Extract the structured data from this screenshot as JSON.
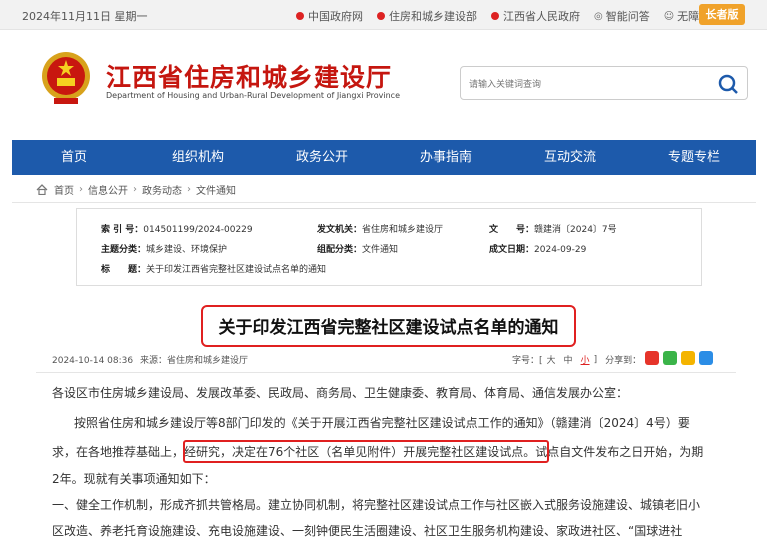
{
  "topbar": {
    "date": "2024年11月11日 星期一",
    "links": [
      "中国政府网",
      "住房和城乡建设部",
      "江西省人民政府",
      "智能问答",
      "无障碍浏览"
    ],
    "elder_mode": "长者版"
  },
  "header": {
    "title": "江西省住房和城乡建设厅",
    "subtitle": "Department of Housing and Urban-Rural Development of Jiangxi Province",
    "search_placeholder": "请输入关键词查询"
  },
  "nav": [
    "首页",
    "组织机构",
    "政务公开",
    "办事指南",
    "互动交流",
    "专题专栏"
  ],
  "breadcrumb": [
    "首页",
    "信息公开",
    "政务动态",
    "文件通知"
  ],
  "meta": {
    "index_label": "索 引 号：",
    "index_value": "014501199/2024-00229",
    "issuer_label": "发文机关：",
    "issuer_value": "省住房和城乡建设厅",
    "docno_label": "文　　号：",
    "docno_value": "赣建消〔2024〕7号",
    "topic_label": "主题分类：",
    "topic_value": "城乡建设、环境保护",
    "genre_label": "组配分类：",
    "genre_value": "文件通知",
    "date_label": "成文日期：",
    "date_value": "2024-09-29",
    "subject_label": "标　　题：",
    "subject_value": "关于印发江西省完整社区建设试点名单的通知"
  },
  "article": {
    "title": "关于印发江西省完整社区建设试点名单的通知",
    "datetime": "2024-10-14 08:36",
    "source": "来源：省住房和城乡建设厅",
    "fontsize_label": "字号：[",
    "size_large": "大",
    "size_medium": "中",
    "size_small": "小",
    "fontsize_end": "]",
    "share_label": "分享到：",
    "paragraphs": {
      "p1": "各设区市住房城乡建设局、发展改革委、民政局、商务局、卫生健康委、教育局、体育局、通信发展办公室：",
      "p2a": "按照省住房和城乡建设厅等8部门印发的《关于开展江西省完整社区建设试点工作的通知》（赣建消〔2024〕4号）要",
      "p2b1": "求，在各地推荐基础上，",
      "p2b_highlight": "经研究，决定在76个社区（名单见附件）开展完整社区建设试点。",
      "p2b2": "试点自文件发布之日开始，为期",
      "p2c": "2年。现就有关事项通知如下：",
      "p3a": "一、健全工作机制，形成齐抓共管格局。建立协同机制，将完整社区建设试点工作与社区嵌入式服务设施建设、城镇老旧小",
      "p3b": "区改造、养老托育设施建设、充电设施建设、一刻钟便民生活圈建设、社区卫生服务机构建设、家政进社区、“国球进社"
    }
  },
  "colors": {
    "nav_bg": "#1d5aab",
    "title_red": "#c5160f",
    "highlight_border": "#e02020",
    "elder_btn": "#f0a22a"
  }
}
